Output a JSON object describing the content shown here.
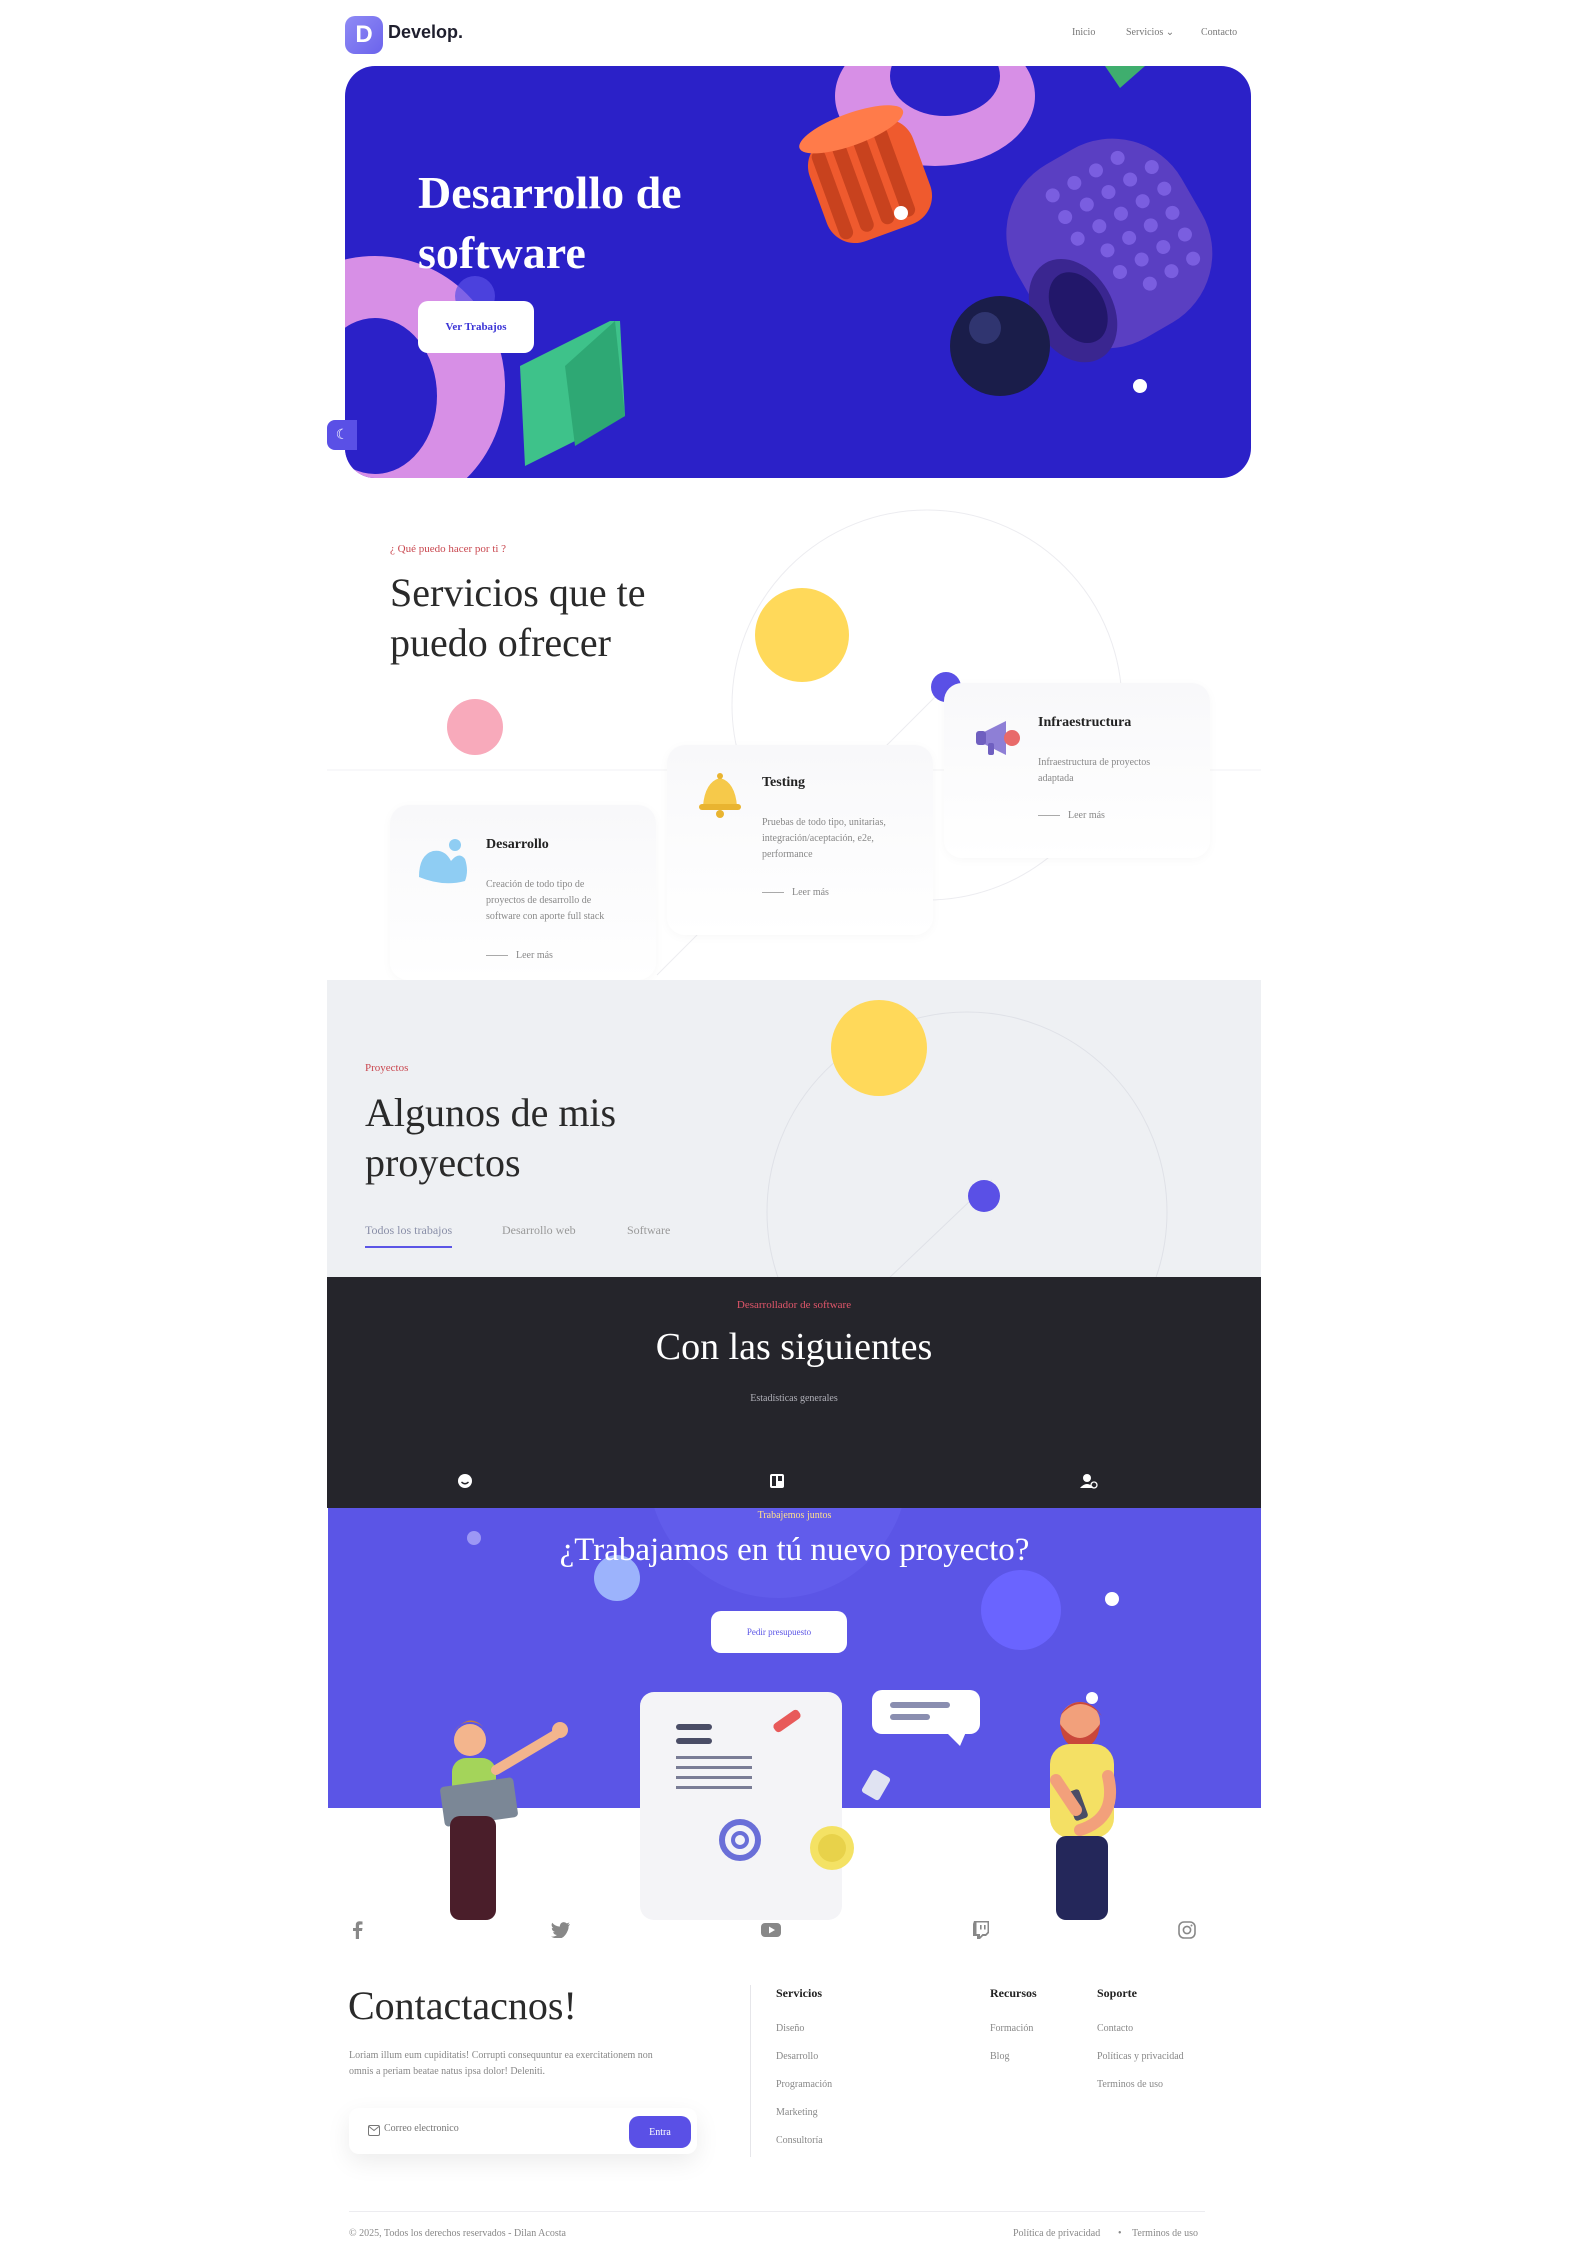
{
  "header": {
    "logo_letter": "D",
    "logo_text": "Develop.",
    "nav": [
      "Inicio",
      "Servicios ⌄",
      "Contacto"
    ]
  },
  "hero": {
    "title_line1": "Desarrollo de",
    "title_line2": "software",
    "button": "Ver Trabajos"
  },
  "services": {
    "eyebrow": "¿ Qué puedo hacer por ti ?",
    "title_line1": "Servicios que te",
    "title_line2": "puedo ofrecer",
    "cards": [
      {
        "title": "Desarrollo",
        "text": [
          "Creación de todo tipo de",
          "proyectos de desarrollo de",
          "software con aporte full stack"
        ],
        "link": "Leer más"
      },
      {
        "title": "Testing",
        "text": [
          "Pruebas de todo tipo, unitarias,",
          "integración/aceptación, e2e,",
          "performance"
        ],
        "link": "Leer más"
      },
      {
        "title": "Infraestructura",
        "text": [
          "Infraestructura de proyectos",
          "adaptada"
        ],
        "link": "Leer más"
      }
    ]
  },
  "projects": {
    "eyebrow": "Proyectos",
    "title_line1": "Algunos de mis",
    "title_line2": "proyectos",
    "tabs": [
      "Todos los trabajos",
      "Desarrollo web",
      "Software"
    ]
  },
  "stats": {
    "eyebrow": "Desarrollador de software",
    "title": "Con las siguientes",
    "subtitle": "Estadísticas generales"
  },
  "cta": {
    "eyebrow": "Trabajemos juntos",
    "title": "¿Trabajamos en tú nuevo proyecto?",
    "button": "Pedir presupuesto"
  },
  "footer": {
    "contact_title": "Contactacnos!",
    "contact_text": [
      "Loriam illum eum cupiditatis! Corrupti consequuntur ea exercitationem non",
      "omnis a periam beatae natus ipsa dolor! Deleniti."
    ],
    "email_placeholder": "Correo electronico",
    "email_button": "Entra",
    "columns": [
      {
        "title": "Servicios",
        "links": [
          "Diseño",
          "Desarrollo",
          "Programación",
          "Marketing",
          "Consultoría"
        ]
      },
      {
        "title": "Recursos",
        "links": [
          "Formación",
          "Blog"
        ]
      },
      {
        "title": "Soporte",
        "links": [
          "Contacto",
          "Políticas y privacidad",
          "Terminos de uso"
        ]
      }
    ],
    "copyright": "© 2025, Todos los derechos reservados - Dilan Acosta",
    "bottom_links": [
      "Política de privacidad",
      "Terminos de uso"
    ]
  },
  "colors": {
    "hero_bg": "#2b21c8",
    "accent": "#5b55e6",
    "stats_bg": "#25252b",
    "eyebrow_red": "#c9474f",
    "yellow": "#ffd95a"
  },
  "icons": {
    "social": [
      "facebook-icon",
      "twitter-icon",
      "youtube-icon",
      "twitch-icon",
      "instagram-icon"
    ],
    "stats": [
      "smile-icon",
      "board-icon",
      "users-icon"
    ]
  }
}
